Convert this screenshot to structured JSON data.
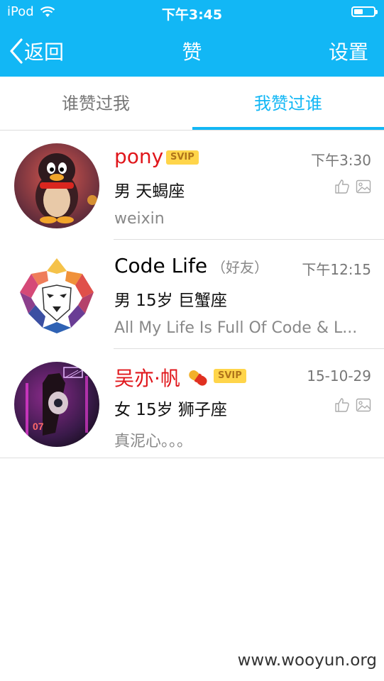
{
  "status_bar": {
    "device": "iPod",
    "time": "下午3:45",
    "battery_level": 0.45
  },
  "nav": {
    "back_label": "返回",
    "title": "赞",
    "settings_label": "设置"
  },
  "tabs": [
    {
      "label": "谁赞过我",
      "active": false
    },
    {
      "label": "我赞过谁",
      "active": true
    }
  ],
  "items": [
    {
      "name": "pony",
      "badge": "SVIP",
      "friend": "",
      "time": "下午3:30",
      "info": "男  天蝎座",
      "signature": "weixin",
      "show_icons": true
    },
    {
      "name": "Code Life",
      "badge": "",
      "friend": "（好友）",
      "time": "下午12:15",
      "info": "男 15岁 巨蟹座",
      "signature": "All My Life Is Full Of Code & L...",
      "show_icons": false
    },
    {
      "name": "吴亦·帆",
      "badge": "SVIP",
      "friend": "",
      "time": "15-10-29",
      "info": "女 15岁 狮子座",
      "signature": "真泥心。。。",
      "show_icons": true
    }
  ],
  "watermark": "www.wooyun.org",
  "colors": {
    "brand": "#12b7f5",
    "vip_name": "#e0161b",
    "badge": "#ffd54a"
  }
}
